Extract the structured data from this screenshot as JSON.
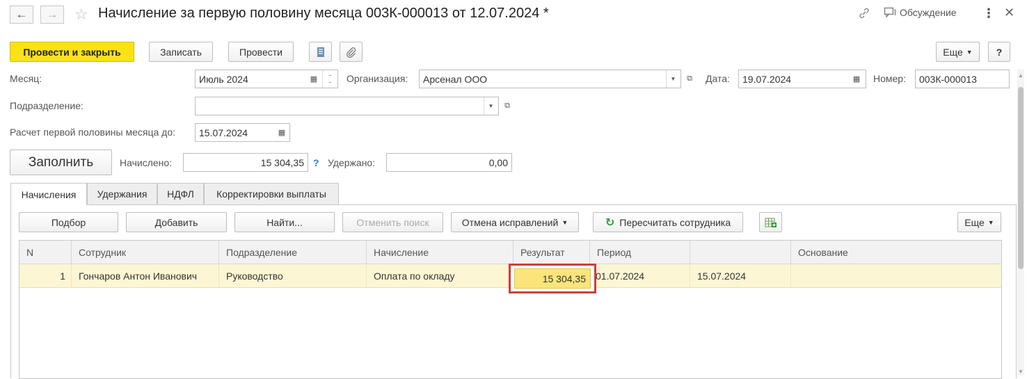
{
  "window": {
    "title": "Начисление за первую половину месяца 003К-000013 от 12.07.2024 *",
    "discuss_label": "Обсуждение"
  },
  "toolbar": {
    "post_close": "Провести и закрыть",
    "save": "Записать",
    "post": "Провести",
    "more": "Еще",
    "help": "?"
  },
  "form": {
    "month_label": "Месяц:",
    "month_value": "Июль 2024",
    "org_label": "Организация:",
    "org_value": "Арсенал ООО",
    "date_label": "Дата:",
    "date_value": "19.07.2024",
    "number_label": "Номер:",
    "number_value": "003К-000013",
    "dept_label": "Подразделение:",
    "dept_value": "",
    "calc_label": "Расчет первой половины месяца до:",
    "calc_value": "15.07.2024",
    "fill_button": "Заполнить",
    "accrued_label": "Начислено:",
    "accrued_value": "15 304,35",
    "help_mark": "?",
    "withheld_label": "Удержано:",
    "withheld_value": "0,00"
  },
  "tabs": [
    {
      "label": "Начисления",
      "active": true
    },
    {
      "label": "Удержания",
      "active": false
    },
    {
      "label": "НДФЛ",
      "active": false
    },
    {
      "label": "Корректировки выплаты",
      "active": false
    }
  ],
  "table_toolbar": {
    "pick": "Подбор",
    "add": "Добавить",
    "find": "Найти...",
    "cancel_search": "Отменить поиск",
    "cancel_fixes": "Отмена исправлений",
    "recalc": "Пересчитать сотрудника",
    "more": "Еще"
  },
  "table": {
    "columns": [
      "N",
      "Сотрудник",
      "Подразделение",
      "Начисление",
      "Результат",
      "Период",
      "",
      "Основание"
    ],
    "rows": [
      [
        "1",
        "Гончаров Антон Иванович",
        "Руководство",
        "Оплата по окладу",
        "15 304,35",
        "01.07.2024",
        "15.07.2024",
        ""
      ]
    ]
  },
  "colors": {
    "primary_button": "#fbe216",
    "row_highlight": "#fdf6d4",
    "selected_cell_border": "#c9413a",
    "recalc_icon": "#2e9e3e",
    "help_mark": "#2a7fc1"
  }
}
